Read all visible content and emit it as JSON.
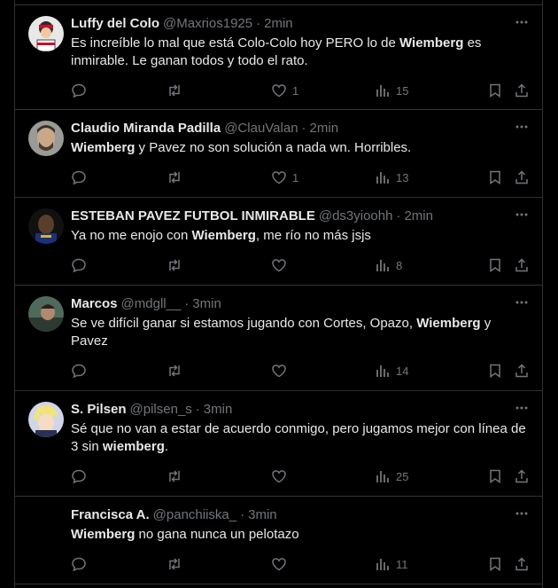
{
  "tweets": [
    {
      "name": "Luffy del Colo",
      "handle": "@Maxrios1925",
      "time": "2min",
      "segments": [
        {
          "t": "Es increíble lo mal que está Colo-Colo hoy PERO lo de ",
          "b": false
        },
        {
          "t": "Wiemberg",
          "b": true
        },
        {
          "t": " es inmirable. Le ganan todos y todo el rato.",
          "b": false
        }
      ],
      "likes": "1",
      "views": "15"
    },
    {
      "name": "Claudio Miranda Padilla",
      "handle": "@ClauValan",
      "time": "2min",
      "segments": [
        {
          "t": "Wiemberg",
          "b": true
        },
        {
          "t": " y Pavez no son solución a nada wn. Horribles.",
          "b": false
        }
      ],
      "likes": "1",
      "views": "13"
    },
    {
      "name": "ESTEBAN PAVEZ FUTBOL INMIRABLE",
      "handle": "@ds3yioohh",
      "time": "2min",
      "segments": [
        {
          "t": "Ya no me enojo con ",
          "b": false
        },
        {
          "t": "Wiemberg",
          "b": true
        },
        {
          "t": ", me río no más jsjs",
          "b": false
        }
      ],
      "likes": "",
      "views": "8"
    },
    {
      "name": "Marcos",
      "handle": "@mdgll__",
      "time": "3min",
      "segments": [
        {
          "t": "Se ve difícil ganar si estamos jugando con Cortes, Opazo, ",
          "b": false
        },
        {
          "t": "Wiemberg",
          "b": true
        },
        {
          "t": " y Pavez",
          "b": false
        }
      ],
      "likes": "",
      "views": "14"
    },
    {
      "name": "S. Pilsen",
      "handle": "@pilsen_s",
      "time": "3min",
      "segments": [
        {
          "t": "Sé que no van a estar de acuerdo conmigo, pero jugamos mejor con línea de 3 sin ",
          "b": false
        },
        {
          "t": "wiemberg",
          "b": true
        },
        {
          "t": ".",
          "b": false
        }
      ],
      "likes": "",
      "views": "25"
    },
    {
      "name": "Francisca A.",
      "handle": "@panchiiska_",
      "time": "3min",
      "segments": [
        {
          "t": "Wiemberg",
          "b": true
        },
        {
          "t": " no gana nunca un pelotazo",
          "b": false
        }
      ],
      "likes": "",
      "views": "11"
    }
  ],
  "separator": "·",
  "colors": {
    "background": "#000000",
    "text": "#e7e9ea",
    "muted": "#71767b",
    "border": "#2f3336"
  },
  "icons": [
    "reply-icon",
    "retweet-icon",
    "like-icon",
    "views-icon",
    "bookmark-icon",
    "share-icon",
    "more-icon"
  ]
}
